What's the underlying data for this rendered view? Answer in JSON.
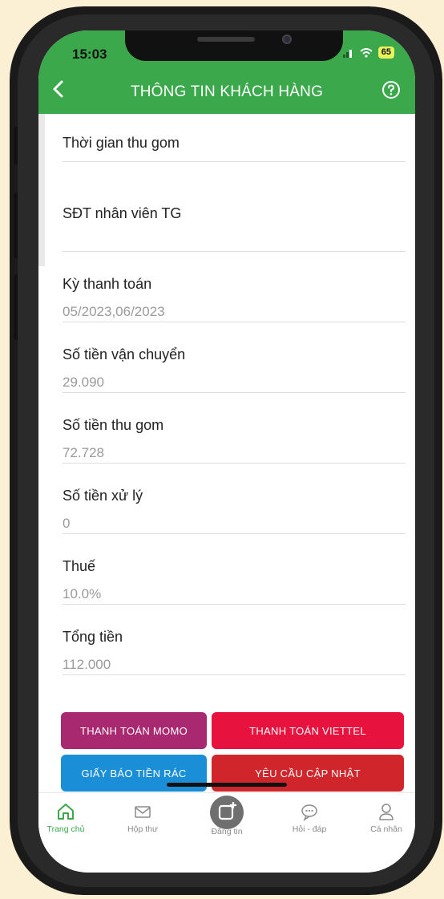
{
  "status_bar": {
    "time": "15:03",
    "battery": "65"
  },
  "header": {
    "title": "THÔNG TIN KHÁCH HÀNG"
  },
  "fields": [
    {
      "label": "Thời gian thu gom",
      "value": ""
    },
    {
      "label": "SĐT nhân viên TG",
      "value": ""
    },
    {
      "label": "Kỳ thanh toán",
      "value": "05/2023,06/2023"
    },
    {
      "label": "Số tiền vận chuyển",
      "value": "29.090"
    },
    {
      "label": "Số tiền thu gom",
      "value": "72.728"
    },
    {
      "label": "Số tiền xử lý",
      "value": "0"
    },
    {
      "label": "Thuế",
      "value": "10.0%"
    },
    {
      "label": "Tổng tiền",
      "value": "112.000"
    }
  ],
  "actions": {
    "momo": "THANH TOÁN MOMO",
    "viettel": "THANH TOÁN VIETTEL",
    "notice": "GIẤY BÁO TIỀN RÁC",
    "update": "YÊU CẦU CẬP NHẬT"
  },
  "action_colors": {
    "momo": "#a8296f",
    "viettel": "#e8123f",
    "notice": "#1a8fd8",
    "update": "#d0262b"
  },
  "bottom_nav": [
    {
      "label": "Trang chủ",
      "icon": "home-icon",
      "active": true
    },
    {
      "label": "Hộp thư",
      "icon": "mail-icon",
      "active": false
    },
    {
      "label": "Đăng tin",
      "icon": "post-icon",
      "active": false
    },
    {
      "label": "Hỏi - đáp",
      "icon": "chat-icon",
      "active": false
    },
    {
      "label": "Cá nhân",
      "icon": "user-icon",
      "active": false
    }
  ],
  "colors": {
    "brand_green": "#3aa84b"
  }
}
